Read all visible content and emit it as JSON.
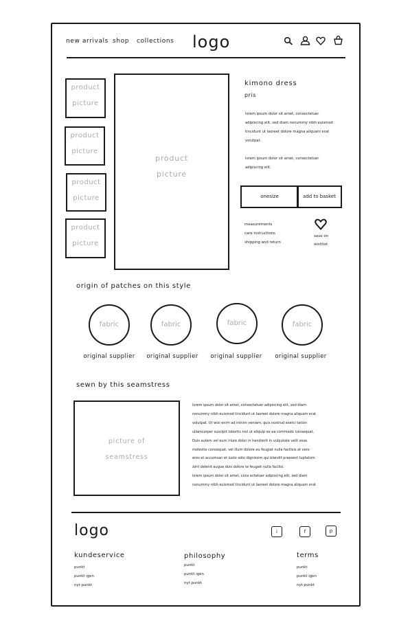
{
  "header": {
    "nav": [
      "new arrivals",
      "shop",
      "collections"
    ],
    "logo": "logo",
    "icons": [
      "search-icon",
      "user-icon",
      "heart-icon",
      "basket-icon"
    ]
  },
  "product": {
    "thumbnails": [
      {
        "line1": "product",
        "line2": "picture"
      },
      {
        "line1": "product",
        "line2": "picture"
      },
      {
        "line1": "product",
        "line2": "picture"
      },
      {
        "line1": "product",
        "line2": "picture"
      }
    ],
    "main_picture": {
      "line1": "product",
      "line2": "picture"
    },
    "title": "kimono dress",
    "price": "pris",
    "description1": [
      "lorem ipsum dolor sit amet, consectetuer",
      "adipiscing elit, sed diam nonummy nibh euismod",
      "tincidunt ut laoreet dolore magna aliquam erat",
      "volutpat."
    ],
    "description2": [
      "lorem ipsum dolor sit amet, consectetuer",
      "adipiscing elit."
    ],
    "size_label": "onesize",
    "add_to_basket": "add to basket",
    "links": [
      "measurements",
      "care instructions",
      "shipping and return"
    ],
    "save_wishlist": [
      "save on",
      "wishlist"
    ]
  },
  "patches": {
    "heading": "origin of patches on this style",
    "items": [
      {
        "fabric": "fabric",
        "supplier": "original supplier"
      },
      {
        "fabric": "fabric",
        "supplier": "original supplier"
      },
      {
        "fabric": "fabric",
        "supplier": "original supplier"
      },
      {
        "fabric": "fabric",
        "supplier": "original supplier"
      }
    ]
  },
  "seamstress": {
    "heading": "sewn by this seamstress",
    "picture": {
      "line1": "picture of",
      "line2": "seamstress"
    },
    "text": [
      "lorem ipsum dolor sit amet, consectetuer adipiscing elit, sed diam",
      "nonummy nibh euismod tincidunt ut laoreet dolore magna aliquam erat",
      "volutpat. Ut wisi enim ad minim veniam, quis nostrud exerci tation",
      "ullamcorper suscipit lobortis nisl ut aliquip ex ea commodo consequat.",
      "Duis autem vel eum iriure dolor in hendrerit in vulputate velit esse",
      "molestie consequat, vel illum dolore eu feugiat nulla facilisis at vero",
      "eros et accumsan et iusto odio dignissim qui blandit praesent luptatum",
      "zzril delenit augue duis dolore te feugait nulla facilisi.",
      "lorem ipsum dolor sit amet, cons ectetuer adipiscing elit, sed diam",
      "nonummy nibh euismod tincidunt ut laoreet dolore magna aliquam erat"
    ]
  },
  "footer": {
    "logo": "logo",
    "social": [
      "i",
      "f",
      "p"
    ],
    "columns": [
      {
        "heading": "kundeservice",
        "links": [
          "punkt",
          "punkt igen",
          "nyt punkt"
        ]
      },
      {
        "heading": "philosophy",
        "links": [
          "punkt",
          "punkt igen",
          "nyt punkt"
        ]
      },
      {
        "heading": "terms",
        "links": [
          "punkt",
          "punkt igen",
          "nyt punkt"
        ]
      }
    ]
  }
}
